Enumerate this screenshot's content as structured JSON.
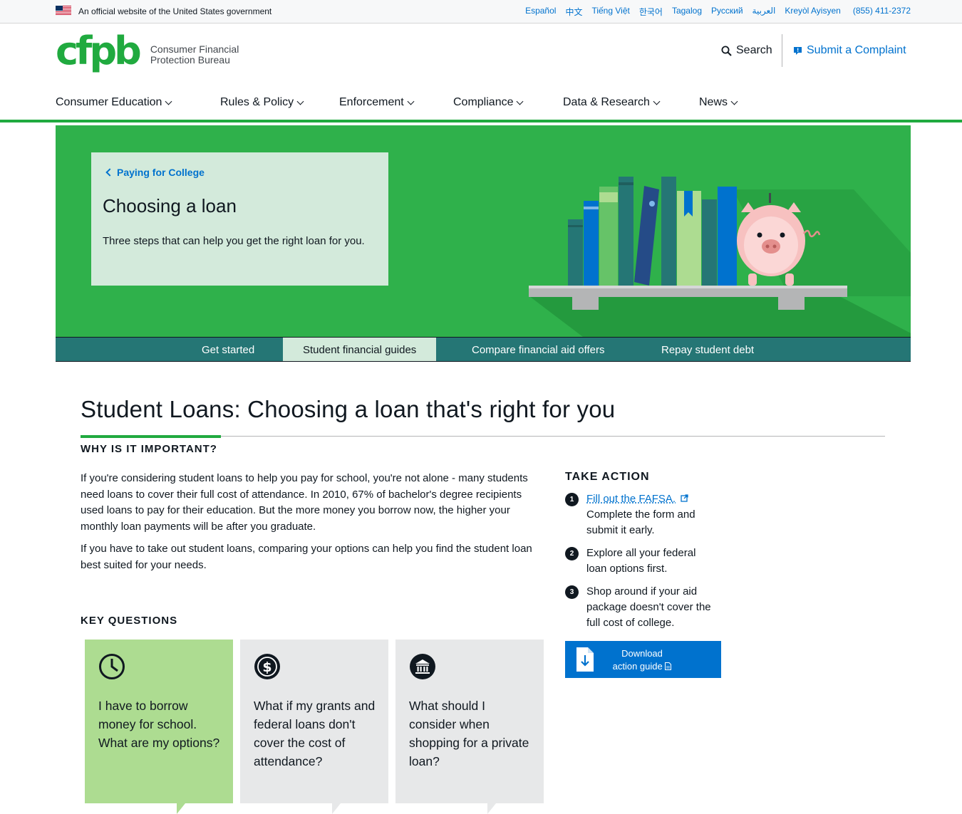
{
  "gov_banner": {
    "text": "An official website of the United States government",
    "languages": [
      "Español",
      "中文",
      "Tiếng Việt",
      "한국어",
      "Tagalog",
      "Русский",
      "العربية",
      "Kreyòl Ayisyen"
    ],
    "phone": "(855) 411-2372"
  },
  "header": {
    "logo_mark": "cfpb",
    "logo_line1": "Consumer Financial",
    "logo_line2": "Protection Bureau",
    "search_label": "Search",
    "complaint_label": "Submit a Complaint"
  },
  "mega_nav": [
    "Consumer Education",
    "Rules & Policy",
    "Enforcement",
    "Compliance",
    "Data & Research",
    "News"
  ],
  "hero": {
    "breadcrumb": "Paying for College",
    "title": "Choosing a loan",
    "subtitle": "Three steps that can help you get the right loan for you."
  },
  "secondary_nav": {
    "items": [
      "Get started",
      "Student financial guides",
      "Compare financial aid offers",
      "Repay student debt"
    ],
    "active": "Student financial guides"
  },
  "main": {
    "title": "Student Loans: Choosing a loan that's right for you",
    "why_heading": "Why is it important?",
    "paragraph1": "If you're considering student loans to help you pay for school, you're not alone - many students need loans to cover their full cost of attendance. In 2010, 67% of bachelor's degree recipients used loans to pay for their education. But the more money you borrow now, the higher your monthly loan payments will be after you graduate.",
    "paragraph2": "If you have to take out student loans, comparing your options can help you find the student loan best suited for your needs.",
    "key_questions_heading": "Key questions"
  },
  "take_action": {
    "title": "TAKE ACTION",
    "steps": [
      {
        "num": "1",
        "link": "Fill out the FAFSA.",
        "text": "Complete the form and submit it early."
      },
      {
        "num": "2",
        "text": "Explore all your federal loan options first."
      },
      {
        "num": "3",
        "text": "Shop around if your aid package doesn't cover the full cost of college."
      }
    ],
    "download_line1": "Download",
    "download_line2": "action guide"
  },
  "key_questions": [
    {
      "icon": "clock-icon",
      "text": "I have to borrow money for school. What are my options?"
    },
    {
      "icon": "dollar-coin-icon",
      "text": "What if my grants and federal loans don't cover the cost of attendance?"
    },
    {
      "icon": "bank-icon",
      "text": "What should I consider when shopping for a private loan?"
    }
  ],
  "colors": {
    "brand_green": "#20aa3f",
    "hero_green": "#2fb14b",
    "link_blue": "#0072ce",
    "teal_nav": "#257675",
    "card_green": "#addc91",
    "card_grey": "#e7e8e9"
  }
}
